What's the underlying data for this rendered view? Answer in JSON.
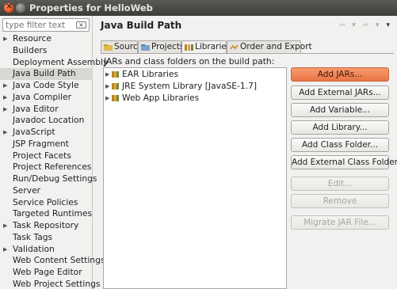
{
  "window": {
    "title": "Properties for HelloWeb"
  },
  "filter": {
    "placeholder": "type filter text",
    "clear_icon": "clear-icon"
  },
  "tree": {
    "items": [
      {
        "label": "Resource",
        "expandable": true
      },
      {
        "label": "Builders",
        "expandable": false
      },
      {
        "label": "Deployment Assembly",
        "expandable": false
      },
      {
        "label": "Java Build Path",
        "expandable": false,
        "selected": true
      },
      {
        "label": "Java Code Style",
        "expandable": true
      },
      {
        "label": "Java Compiler",
        "expandable": true
      },
      {
        "label": "Java Editor",
        "expandable": true
      },
      {
        "label": "Javadoc Location",
        "expandable": false
      },
      {
        "label": "JavaScript",
        "expandable": true
      },
      {
        "label": "JSP Fragment",
        "expandable": false
      },
      {
        "label": "Project Facets",
        "expandable": false
      },
      {
        "label": "Project References",
        "expandable": false
      },
      {
        "label": "Run/Debug Settings",
        "expandable": false
      },
      {
        "label": "Server",
        "expandable": false
      },
      {
        "label": "Service Policies",
        "expandable": false
      },
      {
        "label": "Targeted Runtimes",
        "expandable": false
      },
      {
        "label": "Task Repository",
        "expandable": true
      },
      {
        "label": "Task Tags",
        "expandable": false
      },
      {
        "label": "Validation",
        "expandable": true
      },
      {
        "label": "Web Content Settings",
        "expandable": false
      },
      {
        "label": "Web Page Editor",
        "expandable": false
      },
      {
        "label": "Web Project Settings",
        "expandable": false
      }
    ]
  },
  "page": {
    "heading": "Java Build Path",
    "tabs": [
      {
        "label": "Source",
        "icon": "source-folder-icon"
      },
      {
        "label": "Projects",
        "icon": "projects-icon"
      },
      {
        "label": "Libraries",
        "icon": "libraries-icon",
        "active": true
      },
      {
        "label": "Order and Export",
        "icon": "order-export-icon"
      }
    ],
    "caption": "JARs and class folders on the build path:",
    "libraries": [
      {
        "label": "EAR Libraries"
      },
      {
        "label": "JRE System Library [JavaSE-1.7]"
      },
      {
        "label": "Web App Libraries"
      }
    ],
    "buttons": {
      "add_jars": "Add JARs...",
      "add_external_jars": "Add External JARs...",
      "add_variable": "Add Variable...",
      "add_library": "Add Library...",
      "add_class_folder": "Add Class Folder...",
      "add_external_class_folder": "Add External Class Folder...",
      "edit": "Edit...",
      "remove": "Remove",
      "migrate_jar": "Migrate JAR File..."
    }
  },
  "colors": {
    "primary_button": "#ea7544",
    "selection": "#d9d7d2",
    "titlebar": "#3d3c38"
  }
}
